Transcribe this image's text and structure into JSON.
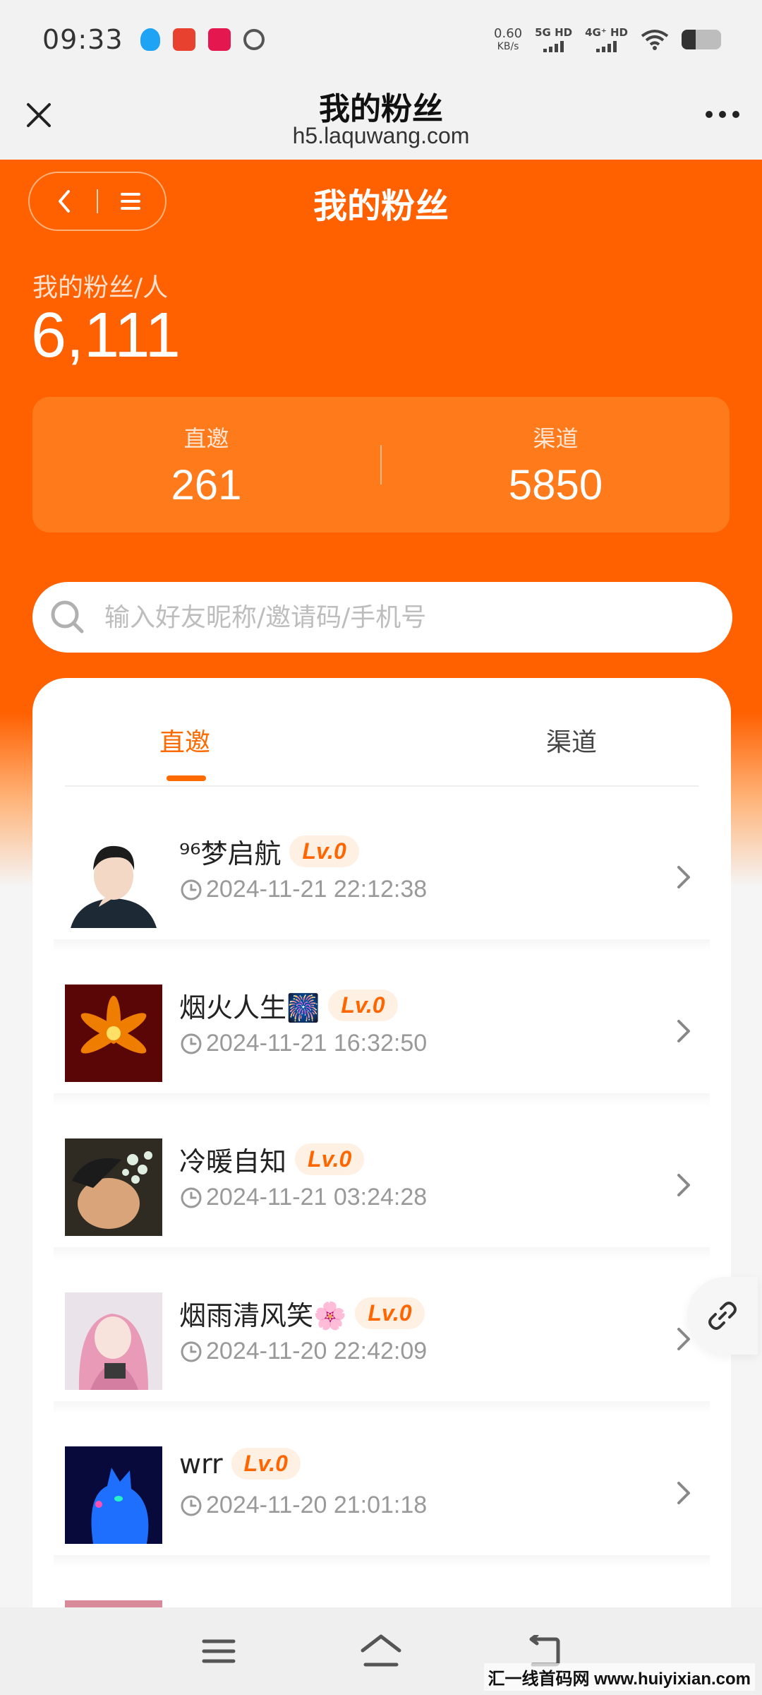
{
  "status_bar": {
    "time": "09:33",
    "app_icons": [
      "qq-icon",
      "gold-badge-icon",
      "red-app-icon",
      "link-app-icon"
    ],
    "net_speed_value": "0.60",
    "net_speed_unit": "KB/s",
    "signal_1_label": "5G HD",
    "signal_2_label": "4G⁺ HD",
    "battery_level": 0.35
  },
  "browser": {
    "title": "我的粉丝",
    "url": "h5.laquwang.com"
  },
  "page": {
    "title": "我的粉丝",
    "fans_label": "我的粉丝/人",
    "fans_count": "6,111",
    "stats": [
      {
        "label": "直邀",
        "value": "261"
      },
      {
        "label": "渠道",
        "value": "5850"
      }
    ],
    "search_placeholder": "输入好友昵称/邀请码/手机号",
    "tabs": [
      {
        "label": "直邀",
        "active": true
      },
      {
        "label": "渠道",
        "active": false
      }
    ],
    "fans": [
      {
        "name": "⁹⁶梦启航",
        "level": "Lv.0",
        "time": "2024-11-21 22:12:38"
      },
      {
        "name": "烟火人生🎆",
        "level": "Lv.0",
        "time": "2024-11-21 16:32:50"
      },
      {
        "name": "冷暖自知",
        "level": "Lv.0",
        "time": "2024-11-21 03:24:28"
      },
      {
        "name": "烟雨清风笑🌸",
        "level": "Lv.0",
        "time": "2024-11-20 22:42:09"
      },
      {
        "name": "wrr",
        "level": "Lv.0",
        "time": "2024-11-20 21:01:18"
      }
    ]
  },
  "colors": {
    "brand_orange": "#ff6000",
    "badge_text": "#ff6600",
    "badge_bg": "#fff0e4"
  },
  "watermark": "汇一线首码网 www.huiyixian.com"
}
